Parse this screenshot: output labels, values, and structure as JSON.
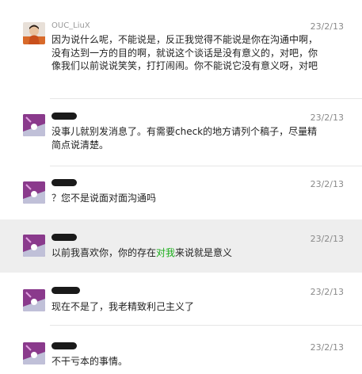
{
  "messages": [
    {
      "sender": "OUC_LiuX",
      "time": "23/2/13",
      "text": "因为说什么呢，不能说是，反正我觉得不能说是你在沟通中啊，没有达到一方的目的啊，就说这个谈话是没有意义的，对吧，你像我们以前说说笑笑，打打闹闹。你不能说它没有意义呀，对吧"
    },
    {
      "sender": "",
      "time": "23/2/13",
      "text": "没事儿就别发消息了。有需要check的地方请列个稿子，尽量精简点说清楚。"
    },
    {
      "sender": "",
      "time": "23/2/13",
      "text": "？您不是说面对面沟通吗"
    },
    {
      "sender": "",
      "time": "23/2/13",
      "text_before": "以前我喜欢你，你的存在",
      "text_highlight": "对我",
      "text_after": "来说就是意义"
    },
    {
      "sender": "",
      "time": "23/2/13",
      "text": "现在不是了，我老精致利己主义了"
    },
    {
      "sender": "",
      "time": "23/2/13",
      "text": "不干亏本的事情。"
    }
  ]
}
